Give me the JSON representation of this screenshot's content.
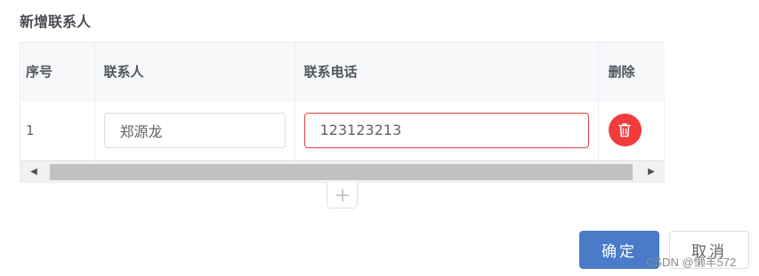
{
  "section_title": "新增联系人",
  "table": {
    "columns": [
      "序号",
      "联系人",
      "联系电话",
      "删除"
    ],
    "rows": [
      {
        "index": "1",
        "contact_name": "郑源龙",
        "phone": "123123213"
      }
    ]
  },
  "scrollbar": {
    "left_arrow": "◀",
    "right_arrow": "▶"
  },
  "buttons": {
    "confirm": "确定",
    "cancel": "取消"
  },
  "colors": {
    "primary": "#4a7bc8",
    "danger": "#f23b3b",
    "error_border": "#e2403f"
  },
  "icons": {
    "delete": "trash-icon",
    "add": "plus-icon"
  },
  "watermark": "CSDN @懒羊572"
}
